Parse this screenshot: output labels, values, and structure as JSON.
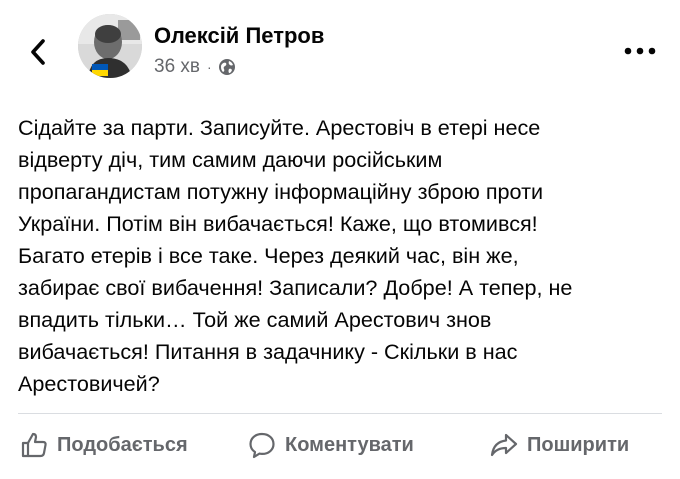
{
  "header": {
    "author_name": "Олексій Петров",
    "timestamp": "36 хв",
    "separator": "·",
    "privacy_icon": "globe-icon",
    "back_icon": "chevron-left-icon",
    "more_icon": "more-options-icon"
  },
  "post": {
    "text": "Сідайте за парти. Записуйте. Арестовіч в етері несе\nвідверту діч, тим самим даючи російським\nпропагандистам потужну інформаційну зброю проти\nУкраїни. Потім він вибачається! Каже, що втомився!\nБагато етерів і все таке. Через деякий час, він же,\nзабирає свої вибачення! Записали? Добре! А тепер, не\nвпадить тільки… Той же самий Арестович знов\nвибачається! Питання в задачнику - Скільки в нас\nАрестовичей?"
  },
  "actions": {
    "like_label": "Подобається",
    "comment_label": "Коментувати",
    "share_label": "Поширити"
  },
  "colors": {
    "text_primary": "#050505",
    "text_secondary": "#65676b",
    "divider": "#dadde1"
  }
}
